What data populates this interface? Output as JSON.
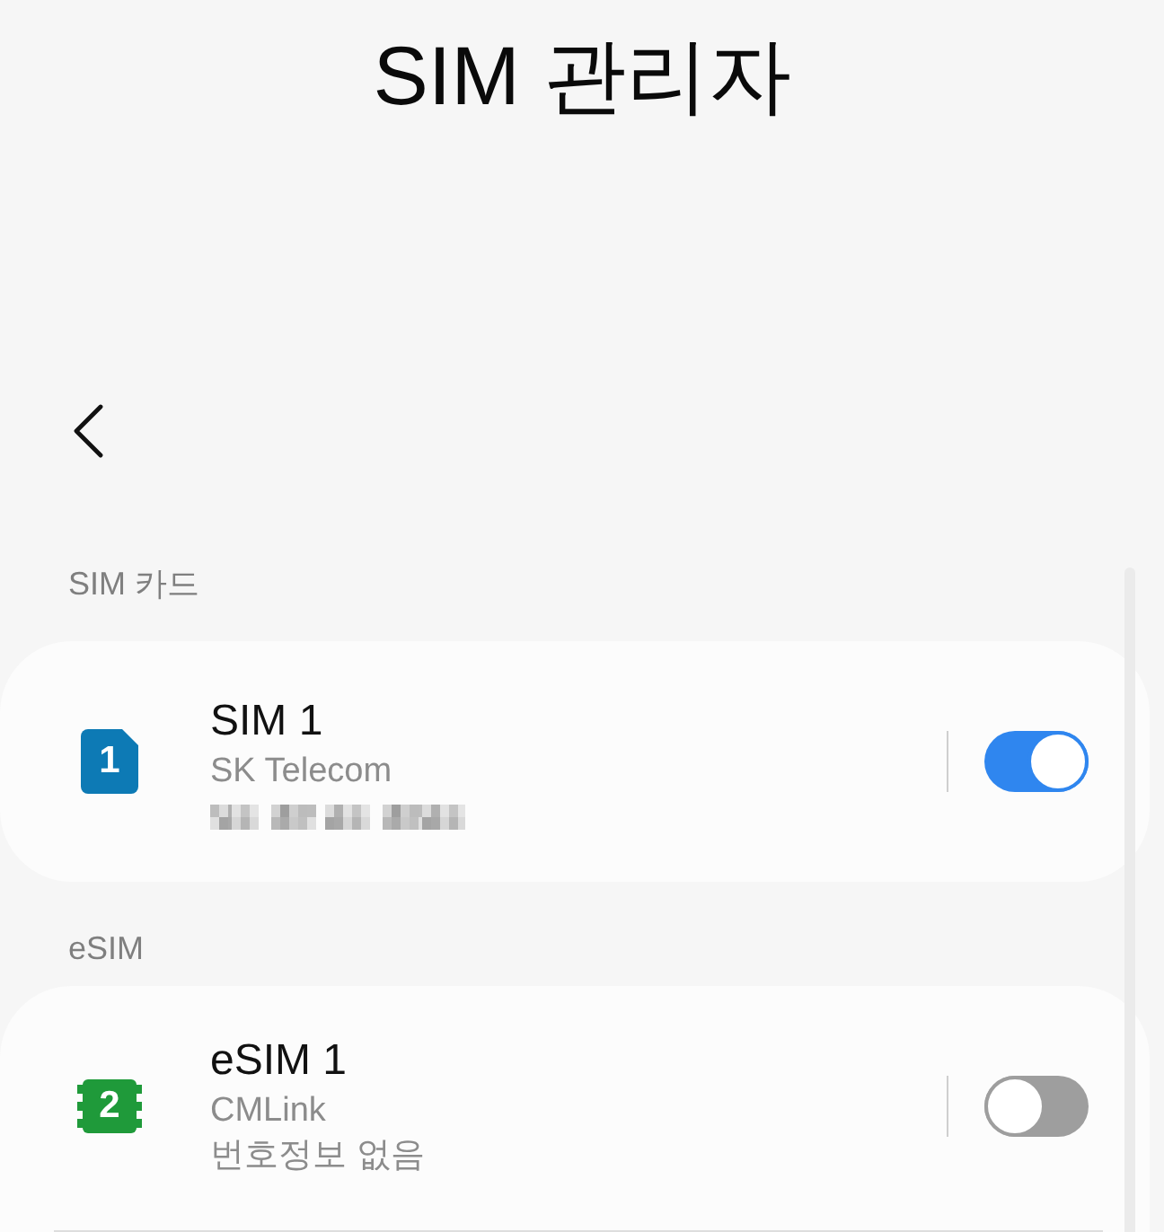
{
  "title": "SIM 관리자",
  "sections": [
    {
      "label": "SIM 카드",
      "items": [
        {
          "kind": "sim",
          "slot_label": "1",
          "name": "SIM 1",
          "carrier": "SK Telecom",
          "redacted": true,
          "on": true
        }
      ]
    },
    {
      "label": "eSIM",
      "items": [
        {
          "kind": "esim",
          "slot_label": "2",
          "name": "eSIM 1",
          "carrier": "CMLink",
          "number": "번호정보 없음",
          "redacted": false,
          "on": false
        }
      ]
    }
  ]
}
